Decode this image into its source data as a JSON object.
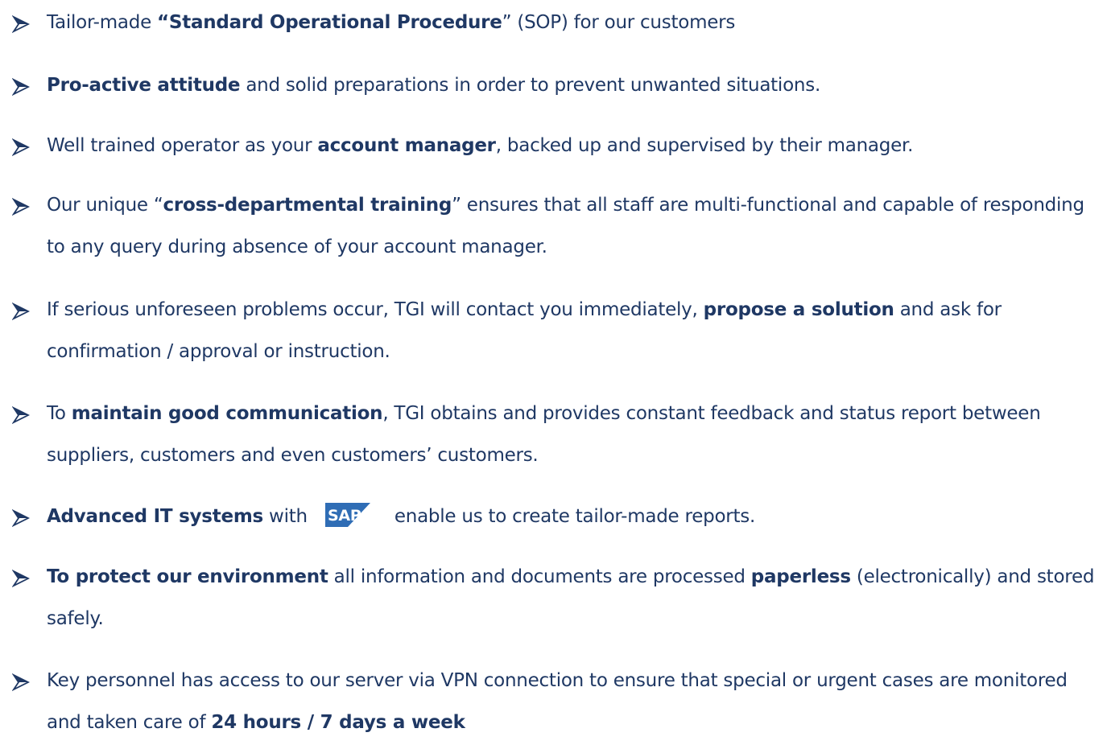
{
  "colors": {
    "text": "#1f3864",
    "sap_blue": "#2f6db5"
  },
  "bullet_icon": "arrowhead-bullet-icon",
  "items": [
    {
      "pre": "Tailor-made ",
      "b1": "“Standard Operational Procedure",
      "post": "” (SOP) for our customers"
    },
    {
      "b1": "Pro-active attitude",
      "post": " and solid preparations in order to prevent unwanted situations."
    },
    {
      "pre": "Well trained operator as your ",
      "b1": "account manager",
      "post": ", backed up and supervised by their manager."
    },
    {
      "pre": "Our unique “",
      "b1": "cross-departmental training",
      "post": "” ensures that all staff are multi-functional and capable of responding to any query during absence of your account manager."
    },
    {
      "pre": "If serious unforeseen problems occur, TGI will contact you immediately, ",
      "b1": "propose a solution",
      "post": " and ask for confirmation / approval or instruction."
    },
    {
      "pre": "To ",
      "b1": "maintain good communication",
      "post": ", TGI obtains and provides constant feedback and status report between suppliers, customers and even customers’ customers."
    },
    {
      "b1": "Advanced IT systems",
      "post": " with",
      "logo_text": "SAP",
      "after_logo": "enable us to create tailor-made reports."
    },
    {
      "b1": "To protect our environment",
      "mid": " all information and documents are processed ",
      "b2": "paperless",
      "post": " (electronically) and stored safely."
    },
    {
      "pre": "Key personnel has access to our server via VPN connection to ensure that special or urgent cases are monitored and taken care of ",
      "b1": "24 hours / 7 days a week"
    }
  ]
}
